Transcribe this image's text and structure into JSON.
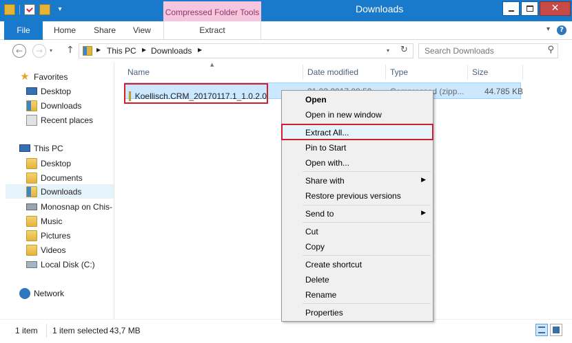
{
  "window": {
    "title": "Downloads",
    "context_tab_header": "Compressed Folder Tools"
  },
  "ribbon": {
    "tabs": [
      "File",
      "Home",
      "Share",
      "View",
      "Extract"
    ]
  },
  "address": {
    "crumbs": [
      "This PC",
      "Downloads"
    ],
    "search_placeholder": "Search Downloads"
  },
  "nav": {
    "favorites": {
      "label": "Favorites",
      "items": [
        "Desktop",
        "Downloads",
        "Recent places"
      ]
    },
    "thispc": {
      "label": "This PC",
      "items": [
        "Desktop",
        "Documents",
        "Downloads",
        "Monosnap on Chis-",
        "Music",
        "Pictures",
        "Videos",
        "Local Disk (C:)"
      ]
    },
    "network": {
      "label": "Network"
    }
  },
  "columns": {
    "name": "Name",
    "date": "Date modified",
    "type": "Type",
    "size": "Size"
  },
  "file": {
    "name": "Koellisch.CRM_20170117.1_1.0.2.0",
    "date_partial": "21.03.2017 09:50",
    "type_partial": "Compressed (zipp...",
    "size": "44.785 KB"
  },
  "context_menu": {
    "items": [
      "Open",
      "Open in new window",
      "Extract All...",
      "Pin to Start",
      "Open with...",
      "Share with",
      "Restore previous versions",
      "Send to",
      "Cut",
      "Copy",
      "Create shortcut",
      "Delete",
      "Rename",
      "Properties"
    ]
  },
  "status": {
    "count": "1 item",
    "selected": "1 item selected",
    "size": "43,7 MB"
  },
  "colors": {
    "accent": "#1979ca",
    "context_tab": "#f5c6dd",
    "highlight": "#d21c26",
    "selection": "#cce8ff"
  }
}
